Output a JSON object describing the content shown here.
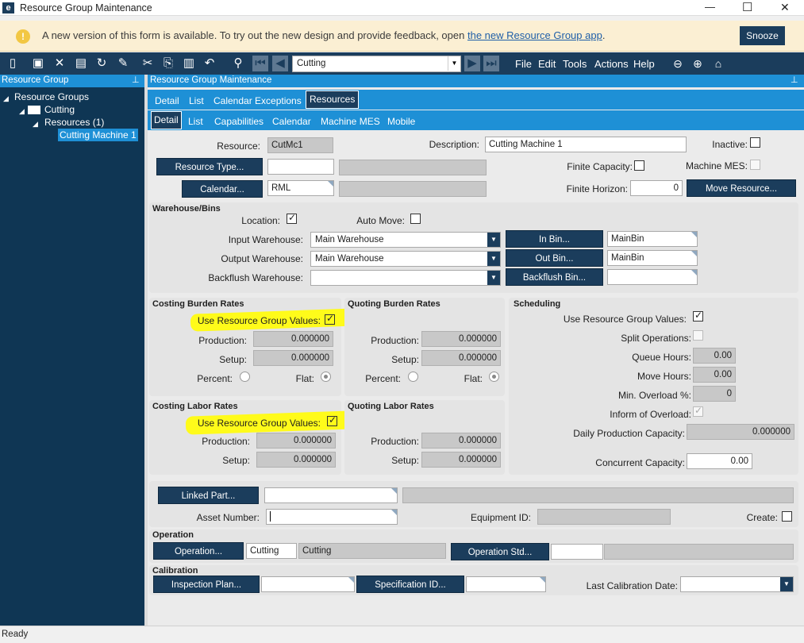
{
  "window": {
    "title": "Resource Group Maintenance",
    "minimize": "—",
    "maximize": "☐",
    "close": "✕"
  },
  "banner": {
    "message": "A new version of this form is available. To try out the new design and provide feedback, open",
    "link": "the new Resource Group app",
    "period": ".",
    "snooze": "Snooze"
  },
  "toolbar": {
    "nav_value": "Cutting",
    "menus": [
      "File",
      "Edit",
      "Tools",
      "Actions",
      "Help"
    ]
  },
  "tree_panel": {
    "title": "Resource Group",
    "root": "Resource Groups",
    "group": "Cutting",
    "resources": "Resources (1)",
    "item": "Cutting Machine 1"
  },
  "main_panel": {
    "title": "Resource Group Maintenance"
  },
  "tabs_top": [
    "Detail",
    "List",
    "Calendar Exceptions",
    "Resources"
  ],
  "tabs_sub": [
    "Detail",
    "List",
    "Capabilities",
    "Calendar",
    "Machine MES",
    "Mobile"
  ],
  "resource": {
    "resource_label": "Resource:",
    "resource_value": "CutMc1",
    "description_label": "Description:",
    "description_value": "Cutting Machine 1",
    "inactive_label": "Inactive:",
    "resource_type_btn": "Resource Type...",
    "finite_capacity_label": "Finite Capacity:",
    "machine_mes_label": "Machine MES:",
    "calendar_btn": "Calendar...",
    "calendar_value": "RML",
    "finite_horizon_label": "Finite Horizon:",
    "finite_horizon_value": "0",
    "move_resource_btn": "Move Resource..."
  },
  "warehouse": {
    "title": "Warehouse/Bins",
    "location_label": "Location:",
    "auto_move_label": "Auto Move:",
    "input_label": "Input Warehouse:",
    "input_value": "Main Warehouse",
    "output_label": "Output Warehouse:",
    "output_value": "Main Warehouse",
    "backflush_label": "Backflush Warehouse:",
    "in_bin_btn": "In Bin...",
    "in_bin_value": "MainBin",
    "out_bin_btn": "Out Bin...",
    "out_bin_value": "MainBin",
    "backflush_bin_btn": "Backflush Bin..."
  },
  "costing_burden": {
    "title": "Costing Burden Rates",
    "use_label": "Use Resource Group Values:",
    "production_label": "Production:",
    "production_value": "0.000000",
    "setup_label": "Setup:",
    "setup_value": "0.000000",
    "percent_label": "Percent:",
    "flat_label": "Flat:"
  },
  "quoting_burden": {
    "title": "Quoting Burden Rates",
    "production_label": "Production:",
    "production_value": "0.000000",
    "setup_label": "Setup:",
    "setup_value": "0.000000",
    "percent_label": "Percent:",
    "flat_label": "Flat:"
  },
  "costing_labor": {
    "title": "Costing Labor Rates",
    "use_label": "Use Resource Group Values:",
    "production_label": "Production:",
    "production_value": "0.000000",
    "setup_label": "Setup:",
    "setup_value": "0.000000"
  },
  "quoting_labor": {
    "title": "Quoting Labor Rates",
    "production_label": "Production:",
    "production_value": "0.000000",
    "setup_label": "Setup:",
    "setup_value": "0.000000"
  },
  "scheduling": {
    "title": "Scheduling",
    "use_label": "Use Resource Group Values:",
    "split_label": "Split Operations:",
    "queue_label": "Queue Hours:",
    "queue_value": "0.00",
    "move_label": "Move Hours:",
    "move_value": "0.00",
    "overload_label": "Min. Overload %:",
    "overload_value": "0",
    "inform_label": "Inform of Overload:",
    "daily_label": "Daily Production Capacity:",
    "daily_value": "0.000000",
    "concurrent_label": "Concurrent Capacity:",
    "concurrent_value": "0.00"
  },
  "linked": {
    "linked_part_btn": "Linked Part...",
    "asset_label": "Asset Number:",
    "equipment_label": "Equipment ID:",
    "create_label": "Create:"
  },
  "operation": {
    "title": "Operation",
    "operation_btn": "Operation...",
    "operation_value": "Cutting",
    "operation_desc": "Cutting",
    "std_btn": "Operation Std..."
  },
  "calibration": {
    "title": "Calibration",
    "inspection_btn": "Inspection Plan...",
    "spec_btn": "Specification ID...",
    "last_label": "Last Calibration Date:"
  },
  "status": {
    "text": "Ready"
  }
}
